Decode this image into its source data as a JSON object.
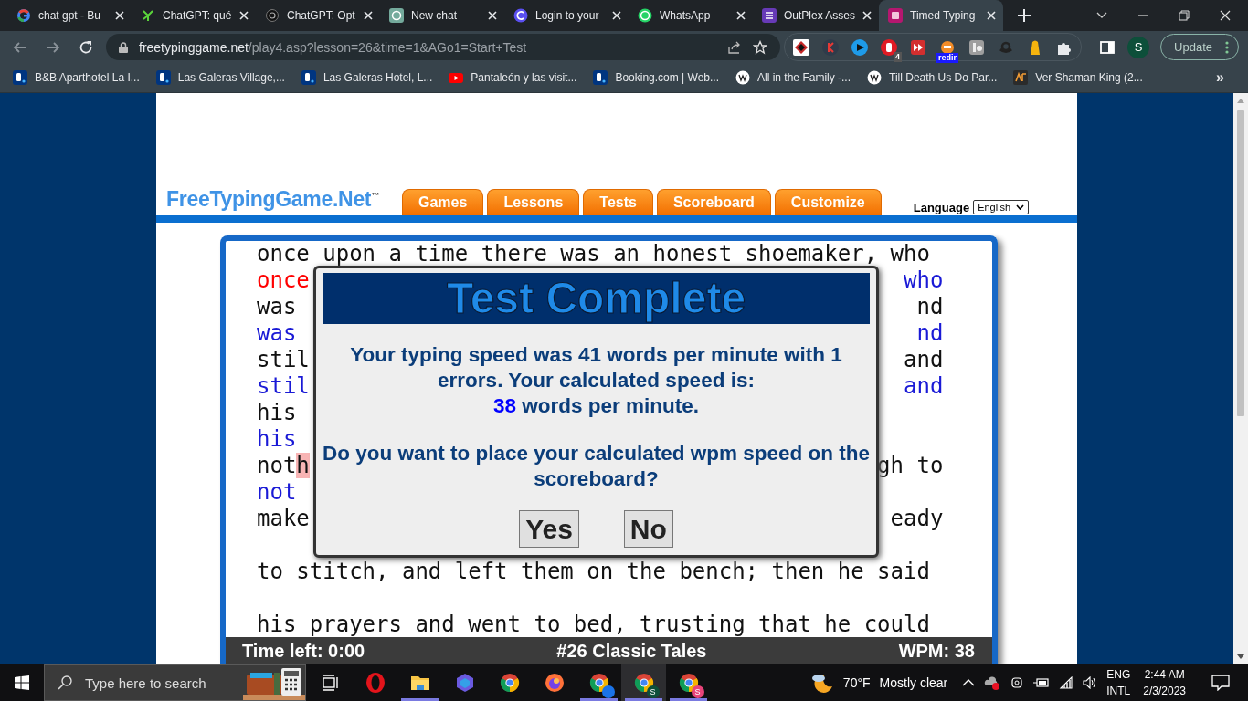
{
  "browser": {
    "tabs": [
      {
        "title": "chat gpt - Bu",
        "kind": "google",
        "selected": false
      },
      {
        "title": "ChatGPT: qué",
        "kind": "tree",
        "selected": false
      },
      {
        "title": "ChatGPT: Opt",
        "kind": "knot",
        "selected": false
      },
      {
        "title": "New chat",
        "kind": "knot-teal",
        "selected": false
      },
      {
        "title": "Login to your",
        "kind": "canva",
        "selected": false
      },
      {
        "title": "WhatsApp",
        "kind": "whatsapp",
        "selected": false
      },
      {
        "title": "OutPlex Asses",
        "kind": "list",
        "selected": false
      },
      {
        "title": "Timed Typing",
        "kind": "magenta",
        "selected": true
      }
    ],
    "address": {
      "host": "freetypinggame.net",
      "path": "/play4.asp?lesson=26&time=1&AGo1=Start+Test"
    },
    "extensions": [
      {
        "kind": "diamond"
      },
      {
        "kind": "dark"
      },
      {
        "kind": "play"
      },
      {
        "kind": "hand",
        "badge": "4"
      },
      {
        "kind": "forward"
      },
      {
        "kind": "robot",
        "badge": "redir"
      },
      {
        "kind": "grey"
      },
      {
        "kind": "smile"
      },
      {
        "kind": "bell"
      },
      {
        "kind": "puzzle"
      }
    ],
    "profile": "S",
    "update_button": "Update"
  },
  "bookmarks": [
    {
      "title": "B&B Aparthotel La I...",
      "kind": "booking"
    },
    {
      "title": "Las Galeras Village,...",
      "kind": "booking"
    },
    {
      "title": "Las Galeras Hotel, L...",
      "kind": "booking"
    },
    {
      "title": "Pantaleón y las visit...",
      "kind": "youtube"
    },
    {
      "title": "Booking.com | Web...",
      "kind": "booking"
    },
    {
      "title": "All in the Family -...",
      "kind": "wiki"
    },
    {
      "title": "Till Death Us Do Par...",
      "kind": "wiki"
    },
    {
      "title": "Ver Shaman King (2...",
      "kind": "af"
    }
  ],
  "bookmarks_more": "»",
  "site": {
    "logo": "FreeTypingGame.Net",
    "logo_mark": "™",
    "nav": [
      "Games",
      "Lessons",
      "Tests",
      "Scoreboard",
      "Customize"
    ],
    "language_label": "Language",
    "language": "English"
  },
  "typing": {
    "lines": [
      {
        "kind": "source",
        "left": [
          {
            "text": "once upon a time there was an honest shoemaker, who",
            "kind": "plain"
          }
        ]
      },
      {
        "kind": "typed",
        "left": [
          {
            "text": "once",
            "kind": "error"
          }
        ],
        "right": "who"
      },
      {
        "kind": "source",
        "left": [
          {
            "text": "was",
            "kind": "plain"
          }
        ],
        "right": "nd"
      },
      {
        "kind": "typed",
        "left": [
          {
            "text": "was",
            "kind": "plain"
          }
        ],
        "right": "nd"
      },
      {
        "kind": "source",
        "left": [
          {
            "text": "stil",
            "kind": "plain"
          }
        ],
        "right": "and"
      },
      {
        "kind": "typed",
        "left": [
          {
            "text": "stil",
            "kind": "plain"
          }
        ],
        "right": "and"
      },
      {
        "kind": "source",
        "left": [
          {
            "text": "his",
            "kind": "plain"
          }
        ]
      },
      {
        "kind": "typed",
        "left": [
          {
            "text": "his",
            "kind": "plain"
          }
        ]
      },
      {
        "kind": "source",
        "left": [
          {
            "text": "not",
            "kind": "plain"
          },
          {
            "text": "h",
            "kind": "cursor"
          }
        ],
        "right": "gh to"
      },
      {
        "kind": "typed",
        "left": [
          {
            "text": "not",
            "kind": "plain"
          }
        ]
      },
      {
        "kind": "source",
        "left": [
          {
            "text": "make",
            "kind": "plain"
          }
        ],
        "right": "eady"
      },
      {
        "kind": "blank"
      },
      {
        "kind": "source",
        "left": [
          {
            "text": "to stitch, and left them on the bench; then he said",
            "kind": "plain"
          }
        ]
      },
      {
        "kind": "blank"
      },
      {
        "kind": "source",
        "left": [
          {
            "text": "his prayers and went to bed, trusting that he could",
            "kind": "plain"
          }
        ]
      }
    ],
    "status": {
      "time_left": "Time left: 0:00",
      "lesson": "#26 Classic Tales",
      "wpm": "WPM: 38"
    }
  },
  "dialog": {
    "title": "Test Complete",
    "result": "Your typing speed was 41 words per minute with 1 errors. Your calculated speed is:",
    "speed": "38",
    "speed_unit": "words per minute.",
    "question": "Do you want to place your calculated wpm speed on the scoreboard?",
    "buttons": [
      "Yes",
      "No"
    ]
  },
  "taskbar": {
    "search_placeholder": "Type here to search",
    "apps": [
      {
        "kind": "opera",
        "running": false,
        "active": false
      },
      {
        "kind": "folder",
        "running": true,
        "active": false
      },
      {
        "kind": "copilot",
        "running": false,
        "active": false
      },
      {
        "kind": "chrome",
        "running": false,
        "active": false
      },
      {
        "kind": "firefox",
        "running": false,
        "active": false
      },
      {
        "kind": "chrome",
        "running": true,
        "active": false,
        "color": "#1a73e8"
      },
      {
        "kind": "chrome",
        "running": true,
        "active": true,
        "color": "#0d4f3a",
        "badge": "S"
      },
      {
        "kind": "chrome",
        "running": true,
        "active": false,
        "color": "#e8447a",
        "badge": "S"
      }
    ],
    "weather": {
      "temp": "70°F",
      "text": "Mostly clear"
    },
    "language": "ENG",
    "layout": "INTL",
    "time": "2:44 AM",
    "date": "2/3/2023"
  }
}
